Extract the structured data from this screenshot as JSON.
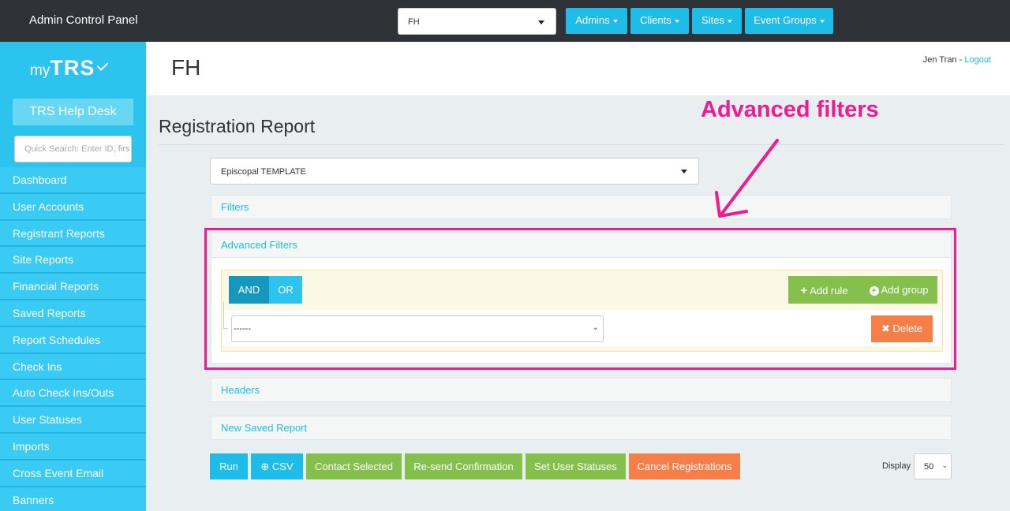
{
  "topbar": {
    "title": "Admin Control Panel",
    "client_select_value": "FH",
    "nav": [
      "Admins",
      "Clients",
      "Sites",
      "Event Groups"
    ]
  },
  "sidebar": {
    "logo_small": "my",
    "logo_big": "TRS",
    "help_desk": "TRS Help Desk",
    "quick_search_placeholder": "Quick Search: Enter ID, firs",
    "items": [
      "Dashboard",
      "User Accounts",
      "Registrant Reports",
      "Site Reports",
      "Financial Reports",
      "Saved Reports",
      "Report Schedules",
      "Check Ins",
      "Auto Check Ins/Outs",
      "User Statuses",
      "Imports",
      "Cross Event Email",
      "Banners"
    ]
  },
  "header": {
    "title": "FH",
    "user_name": "Jen Tran",
    "separator": " - ",
    "logout": "Logout"
  },
  "main": {
    "page_title": "Registration Report",
    "report_select_value": "Episcopal TEMPLATE",
    "panels": {
      "filters": "Filters",
      "advanced_filters": "Advanced Filters",
      "headers": "Headers",
      "new_saved_report": "New Saved Report"
    },
    "query_builder": {
      "and": "AND",
      "or": "OR",
      "add_rule": "Add rule",
      "add_group": "Add group",
      "rule_select_value": "------",
      "delete": "Delete"
    },
    "actions": {
      "run": "Run",
      "csv": "CSV",
      "contact_selected": "Contact Selected",
      "resend_confirmation": "Re-send Confirmation",
      "set_user_statuses": "Set User Statuses",
      "cancel_registrations": "Cancel Registrations"
    },
    "display_label": "Display",
    "display_value": "50"
  },
  "annotation": {
    "text": "Advanced filters"
  },
  "colors": {
    "accent": "#1ebde9",
    "topbar": "#2f3237",
    "green": "#86c04c",
    "orange": "#f57e49",
    "annotation": "#ee1c8f"
  }
}
